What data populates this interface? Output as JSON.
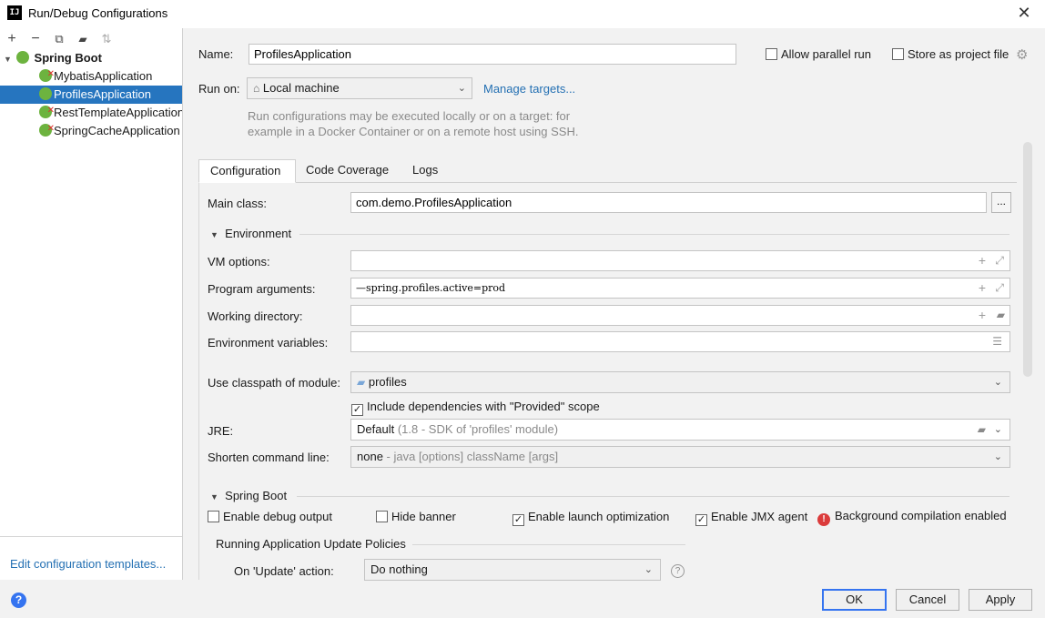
{
  "window": {
    "title": "Run/Debug Configurations"
  },
  "toolbar": {
    "add": "+",
    "remove": "−",
    "copy": "⧉",
    "folder": "▰",
    "sort": "⇅"
  },
  "tree": {
    "group": "Spring Boot",
    "items": [
      {
        "label": "MybatisApplication",
        "error": true,
        "selected": false
      },
      {
        "label": "ProfilesApplication",
        "error": false,
        "selected": true
      },
      {
        "label": "RestTemplateApplication",
        "error": true,
        "selected": false
      },
      {
        "label": "SpringCacheApplication",
        "error": true,
        "selected": false
      }
    ]
  },
  "left_footer": {
    "edit_templates": "Edit configuration templates..."
  },
  "header": {
    "name_label": "Name:",
    "name_value": "ProfilesApplication",
    "allow_parallel_label": "Allow parallel run",
    "store_as_project_label": "Store as project file",
    "run_on_label": "Run on:",
    "run_on_value": "Local machine",
    "manage_targets": "Manage targets...",
    "run_on_hint_1": "Run configurations may be executed locally or on a target: for",
    "run_on_hint_2": "example in a Docker Container or on a remote host using SSH."
  },
  "tabs": [
    "Configuration",
    "Code Coverage",
    "Logs"
  ],
  "config": {
    "main_class_label": "Main class:",
    "main_class_value": "com.demo.ProfilesApplication",
    "browse_button": "...",
    "environment_section": "Environment",
    "vm_options_label": "VM options:",
    "vm_options_value": "",
    "program_args_label": "Program arguments:",
    "program_args_value": "—spring.profiles.active=prod",
    "working_dir_label": "Working directory:",
    "working_dir_value": "",
    "env_vars_label": "Environment variables:",
    "env_vars_value": "",
    "classpath_label": "Use classpath of module:",
    "classpath_value": "profiles",
    "include_deps_label": "Include dependencies with \"Provided\" scope",
    "include_deps_checked": true,
    "jre_label": "JRE:",
    "jre_value": "Default",
    "jre_hint": "(1.8 - SDK of 'profiles' module)",
    "shorten_label": "Shorten command line:",
    "shorten_value": "none",
    "shorten_hint": "- java [options] className [args]",
    "spring_boot_section": "Spring Boot",
    "enable_debug_label": "Enable debug output",
    "enable_debug_checked": false,
    "hide_banner_label": "Hide banner",
    "hide_banner_checked": false,
    "launch_opt_label": "Enable launch optimization",
    "launch_opt_checked": true,
    "jmx_label": "Enable JMX agent",
    "jmx_checked": true,
    "bg_compilation_label": "Background compilation enabled",
    "update_policies_label": "Running Application Update Policies",
    "on_update_label": "On 'Update' action:",
    "on_update_value": "Do nothing"
  },
  "buttons": {
    "ok": "OK",
    "cancel": "Cancel",
    "apply": "Apply"
  },
  "colors": {
    "accent": "#2675bf",
    "link": "#2470b3",
    "spring": "#6db33f",
    "error": "#db3b3b"
  }
}
